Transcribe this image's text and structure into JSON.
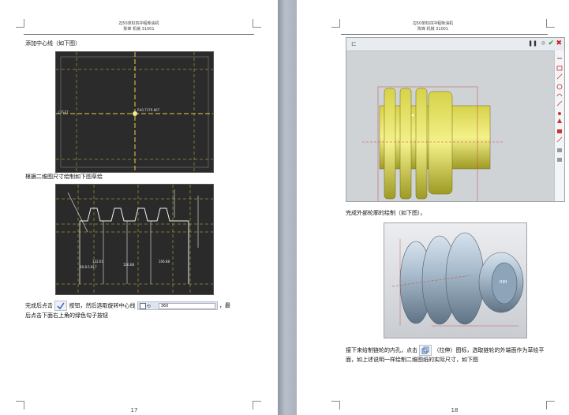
{
  "header": {
    "line1": "ZJ50单缸四冲程柴油机",
    "line2": "陈锋 机械 31001"
  },
  "page_left": {
    "text1": "添加中心线（如下图）",
    "sketch1": {
      "dimension_label": "R40.7379.867",
      "left_label": "CFSET"
    },
    "text2": "根据二维图尺寸绘制如下图草绘",
    "sketch2": {
      "dim_labels": [
        "132.01",
        "56.8.5.817",
        "116.68",
        "106.88"
      ]
    },
    "text3_part1": "完成后点击",
    "text3_part2": "按钮，然后选取旋转中心线",
    "text3_part3": "，最",
    "text3_line2": "后点击下面右上角的绿色勾子按钮",
    "toolbar_value": "360",
    "page_number": "17"
  },
  "page_right": {
    "text1": "完成外部轮廓的绘制（如下图）。",
    "text2_part1": "接下来给制链轮的内孔，点击",
    "text2_part2": "（拉伸）图标，选取链轮的外端面作为草绘平",
    "text2_line2": "面，如上述说明一样绘制二维图纸的实际尺寸，如下图",
    "model_label": "RIM",
    "page_number": "18"
  }
}
